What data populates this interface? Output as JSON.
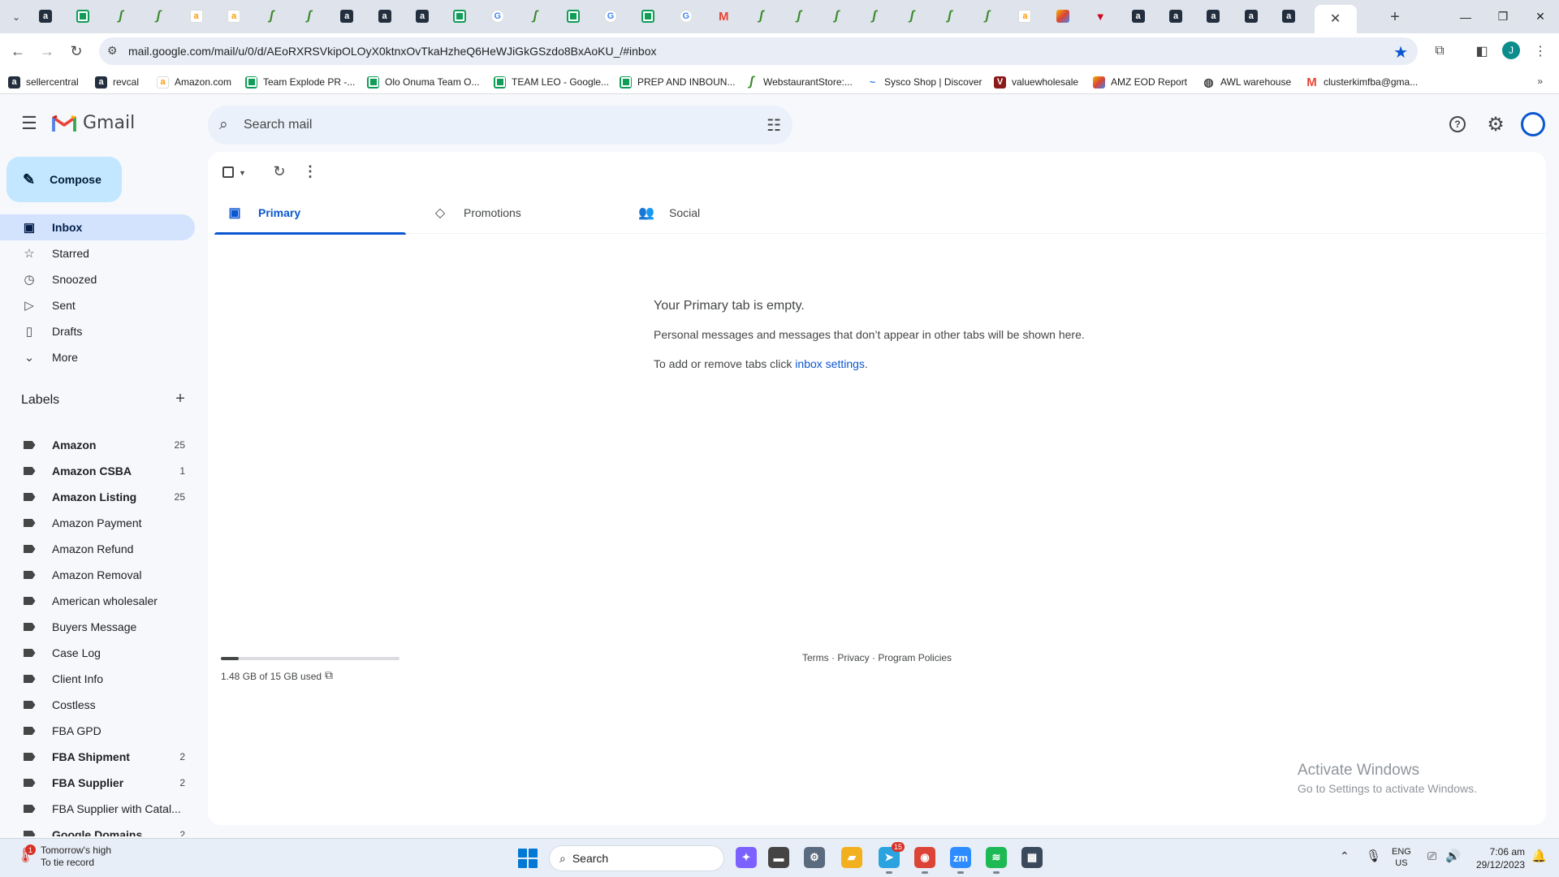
{
  "browser": {
    "tabs": [
      {
        "icon": "amazon-icon",
        "glyph": "a",
        "kind": "amazon"
      },
      {
        "icon": "sheets-icon",
        "glyph": "",
        "kind": "sheets"
      },
      {
        "icon": "webstore-icon",
        "glyph": "ʃ",
        "kind": "webstore"
      },
      {
        "icon": "webstore-icon",
        "glyph": "ʃ",
        "kind": "webstore"
      },
      {
        "icon": "amazon-smile-icon",
        "glyph": "a",
        "kind": "amazon-light"
      },
      {
        "icon": "amazon-smile-icon",
        "glyph": "a",
        "kind": "amazon-light"
      },
      {
        "icon": "webstore-icon",
        "glyph": "ʃ",
        "kind": "webstore"
      },
      {
        "icon": "webstore-icon",
        "glyph": "ʃ",
        "kind": "webstore"
      },
      {
        "icon": "amazon-icon",
        "glyph": "a",
        "kind": "amazon"
      },
      {
        "icon": "amazon-icon",
        "glyph": "a",
        "kind": "amazon"
      },
      {
        "icon": "amazon-icon",
        "glyph": "a",
        "kind": "amazon"
      },
      {
        "icon": "sheets-icon",
        "glyph": "",
        "kind": "sheets"
      },
      {
        "icon": "google-icon",
        "glyph": "G",
        "kind": "google"
      },
      {
        "icon": "webstore-icon",
        "glyph": "ʃ",
        "kind": "webstore"
      },
      {
        "icon": "sheets-icon",
        "glyph": "",
        "kind": "sheets"
      },
      {
        "icon": "google-icon",
        "glyph": "G",
        "kind": "google"
      },
      {
        "icon": "sheets-icon",
        "glyph": "",
        "kind": "sheets"
      },
      {
        "icon": "google-icon",
        "glyph": "G",
        "kind": "google"
      },
      {
        "icon": "gmail-icon",
        "glyph": "M",
        "kind": "gmail"
      },
      {
        "icon": "webstore-icon",
        "glyph": "ʃ",
        "kind": "webstore"
      },
      {
        "icon": "webstore-icon",
        "glyph": "ʃ",
        "kind": "webstore"
      },
      {
        "icon": "webstore-icon",
        "glyph": "ʃ",
        "kind": "webstore"
      },
      {
        "icon": "webstore-icon",
        "glyph": "ʃ",
        "kind": "webstore"
      },
      {
        "icon": "webstore-icon",
        "glyph": "ʃ",
        "kind": "webstore"
      },
      {
        "icon": "webstore-icon",
        "glyph": "ʃ",
        "kind": "webstore"
      },
      {
        "icon": "webstore-icon",
        "glyph": "ʃ",
        "kind": "webstore"
      },
      {
        "icon": "amazon-smile-icon",
        "glyph": "a",
        "kind": "amazon-light"
      },
      {
        "icon": "pen-app-icon",
        "glyph": "",
        "kind": "pen"
      },
      {
        "icon": "triangle-app-icon",
        "glyph": "▼",
        "kind": "tri"
      },
      {
        "icon": "amazon-icon",
        "glyph": "a",
        "kind": "amazon"
      },
      {
        "icon": "amazon-icon",
        "glyph": "a",
        "kind": "amazon"
      },
      {
        "icon": "amazon-icon",
        "glyph": "a",
        "kind": "amazon"
      },
      {
        "icon": "amazon-icon",
        "glyph": "a",
        "kind": "amazon"
      },
      {
        "icon": "amazon-icon",
        "glyph": "a",
        "kind": "amazon"
      }
    ],
    "active_tab_close": "✕",
    "url": "mail.google.com/mail/u/0/d/AEoRXRSVkipOLOyX0ktnxOvTkaHzheQ6HeWJiGkGSzdo8BxAoKU_/#inbox",
    "profile_initial": "J",
    "profile_color": "#0c8c8c",
    "bookmarks": [
      {
        "label": "sellercentral",
        "kind": "amazon",
        "glyph": "a"
      },
      {
        "label": "revcal",
        "kind": "amazon",
        "glyph": "a"
      },
      {
        "label": "Amazon.com",
        "kind": "amazon-light",
        "glyph": "a"
      },
      {
        "label": "Team Explode PR -...",
        "kind": "sheets",
        "glyph": ""
      },
      {
        "label": "Olo Onuma Team O...",
        "kind": "sheets",
        "glyph": ""
      },
      {
        "label": "TEAM LEO - Google...",
        "kind": "sheets",
        "glyph": ""
      },
      {
        "label": "PREP AND INBOUN...",
        "kind": "sheets",
        "glyph": ""
      },
      {
        "label": "WebstaurantStore:...",
        "kind": "webstore",
        "glyph": "ʃ"
      },
      {
        "label": "Sysco Shop | Discover",
        "kind": "sysco",
        "glyph": "~"
      },
      {
        "label": "valuewholesale",
        "kind": "vw",
        "glyph": "V"
      },
      {
        "label": "AMZ EOD Report",
        "kind": "pen",
        "glyph": ""
      },
      {
        "label": "AWL warehouse",
        "kind": "globe",
        "glyph": "◍"
      },
      {
        "label": "clusterkimfba@gma...",
        "kind": "gmail",
        "glyph": "M"
      }
    ]
  },
  "gmail": {
    "wordmark": "Gmail",
    "search_placeholder": "Search mail",
    "compose": "Compose",
    "nav": [
      {
        "label": "Inbox",
        "icon": "inbox-icon",
        "glyph": "▣",
        "active": true
      },
      {
        "label": "Starred",
        "icon": "star-icon",
        "glyph": "☆",
        "active": false
      },
      {
        "label": "Snoozed",
        "icon": "clock-icon",
        "glyph": "◷",
        "active": false
      },
      {
        "label": "Sent",
        "icon": "send-icon",
        "glyph": "▷",
        "active": false
      },
      {
        "label": "Drafts",
        "icon": "draft-icon",
        "glyph": "▯",
        "active": false
      },
      {
        "label": "More",
        "icon": "chevron-down-icon",
        "glyph": "⌄",
        "active": false
      }
    ],
    "labels_title": "Labels",
    "labels": [
      {
        "name": "Amazon",
        "count": "25",
        "bold": true
      },
      {
        "name": "Amazon CSBA",
        "count": "1",
        "bold": true
      },
      {
        "name": "Amazon Listing",
        "count": "25",
        "bold": true
      },
      {
        "name": "Amazon Payment",
        "count": "",
        "bold": false
      },
      {
        "name": "Amazon Refund",
        "count": "",
        "bold": false
      },
      {
        "name": "Amazon Removal",
        "count": "",
        "bold": false
      },
      {
        "name": "American wholesaler",
        "count": "",
        "bold": false
      },
      {
        "name": "Buyers Message",
        "count": "",
        "bold": false
      },
      {
        "name": "Case Log",
        "count": "",
        "bold": false
      },
      {
        "name": "Client Info",
        "count": "",
        "bold": false
      },
      {
        "name": "Costless",
        "count": "",
        "bold": false
      },
      {
        "name": "FBA GPD",
        "count": "",
        "bold": false
      },
      {
        "name": "FBA Shipment",
        "count": "2",
        "bold": true
      },
      {
        "name": "FBA Supplier",
        "count": "2",
        "bold": true
      },
      {
        "name": "FBA Supplier with Catal...",
        "count": "",
        "bold": false
      },
      {
        "name": "Google Domains",
        "count": "2",
        "bold": true
      }
    ],
    "tabs": [
      {
        "label": "Primary",
        "icon": "inbox-icon",
        "glyph": "▣",
        "active": true
      },
      {
        "label": "Promotions",
        "icon": "tag-icon",
        "glyph": "◇",
        "active": false
      },
      {
        "label": "Social",
        "icon": "people-icon",
        "glyph": "👥",
        "active": false
      }
    ],
    "empty": {
      "title": "Your Primary tab is empty.",
      "desc": "Personal messages and messages that don’t appear in other tabs will be shown here.",
      "hint_prefix": "To add or remove tabs click ",
      "hint_link": "inbox settings",
      "hint_suffix": "."
    },
    "storage": {
      "used_text": "1.48 GB of 15 GB used",
      "fraction": 0.0987
    },
    "footer": {
      "terms": "Terms",
      "privacy": "Privacy",
      "policies": "Program Policies",
      "sep": " · "
    },
    "activate": {
      "title": "Activate Windows",
      "subtitle": "Go to Settings to activate Windows."
    }
  },
  "taskbar": {
    "weather_line1": "Tomorrow's high",
    "weather_line2": "To tie record",
    "weather_badge": "1",
    "search_label": "Search",
    "apps": [
      {
        "name": "copilot-app-icon",
        "glyph": "✦",
        "color": "#7b61ff",
        "running": false
      },
      {
        "name": "notepad-app-icon",
        "glyph": "▬",
        "color": "#444444",
        "running": false
      },
      {
        "name": "settings-app-icon",
        "glyph": "⚙",
        "color": "#5b6b7f",
        "running": false
      },
      {
        "name": "file-explorer-app-icon",
        "glyph": "▰",
        "color": "#f2b01e",
        "running": false
      },
      {
        "name": "telegram-app-icon",
        "glyph": "➤",
        "color": "#2aa3df",
        "running": true,
        "badge": "15"
      },
      {
        "name": "chrome-app-icon",
        "glyph": "◉",
        "color": "#db4437",
        "running": true
      },
      {
        "name": "zoom-app-icon",
        "glyph": "zm",
        "color": "#2d8cff",
        "running": true
      },
      {
        "name": "spotify-app-icon",
        "glyph": "≋",
        "color": "#1db954",
        "running": true
      },
      {
        "name": "calculator-app-icon",
        "glyph": "▦",
        "color": "#3a4a5c",
        "running": false
      }
    ],
    "lang_line1": "ENG",
    "lang_line2": "US",
    "time": "7:06 am",
    "date": "29/12/2023"
  }
}
